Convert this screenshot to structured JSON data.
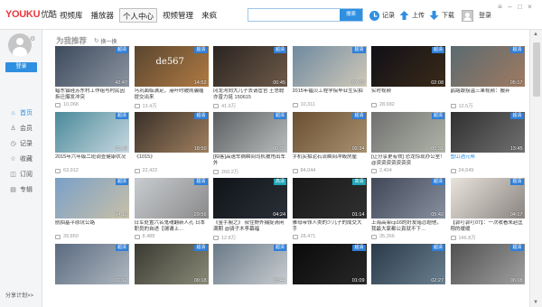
{
  "app": {
    "logo_you": "YOUKU",
    "logo_sub": "优酷",
    "nav": [
      "视频库",
      "播放器",
      "个人中心",
      "视频管理",
      "来疯"
    ],
    "search": {
      "placeholder": "",
      "button": "搜索"
    },
    "tools": {
      "record": "记录",
      "upload": "上传",
      "download": "下载",
      "login": "登录"
    },
    "window_controls": [
      "≡",
      "–",
      "□",
      "×"
    ]
  },
  "sidebar": {
    "login_button": "登录",
    "menu": [
      {
        "icon": "home-icon",
        "glyph": "⌂",
        "label": "首页"
      },
      {
        "icon": "member-icon",
        "glyph": "♙",
        "label": "会员"
      },
      {
        "icon": "history-icon",
        "glyph": "◷",
        "label": "记录"
      },
      {
        "icon": "favorite-icon",
        "glyph": "☆",
        "label": "收藏"
      },
      {
        "icon": "subscribe-icon",
        "glyph": "◫",
        "label": "订阅"
      },
      {
        "icon": "album-icon",
        "glyph": "▤",
        "label": "专辑"
      }
    ],
    "share_plan": "分享计划>>"
  },
  "main": {
    "section_title": "为我推荐",
    "refresh": "换一换",
    "videos": [
      {
        "title": "蜡东镇硅苏东村工作组与村民因拆迁爆发冲突",
        "views": "10,068",
        "duration": "42:47",
        "badge": "超清",
        "bg": [
          "#3c4a5c",
          "#8c94a0"
        ]
      },
      {
        "title": "冯巩面临满足，港叶时被闹骗缠提交出来",
        "views": "13.4万",
        "duration": "14:52",
        "badge": "超清",
        "bg": [
          "#5a4630",
          "#b07a42"
        ],
        "overlay": "de567"
      },
      {
        "title": "冈龙沟向大儿子去请宦官 王思聪亦曾力挺 150615",
        "views": "41.9万",
        "duration": "00:45",
        "badge": "超清",
        "bg": [
          "#2a2420",
          "#6e5a4a"
        ]
      },
      {
        "title": "2015年福贝工程学院毕业生实拍",
        "views": "10,311",
        "duration": "07:09",
        "badge": "超清",
        "bg": [
          "#6e8aa0",
          "#d0c8b8"
        ]
      },
      {
        "title": "实时视频",
        "views": "28,682",
        "duration": "02:08",
        "badge": "超清",
        "bg": [
          "#101018",
          "#3a2a18"
        ]
      },
      {
        "title": "鹊路跟拐温三果视频：搬弃",
        "views": "12.5万",
        "duration": "05:17",
        "badge": "超清",
        "bg": [
          "#5a6a70",
          "#a07a60"
        ]
      },
      {
        "title": "2015年六年级二班调查健康状况",
        "views": "63,912",
        "duration": "01:49",
        "badge": "超清",
        "bg": [
          "#4a8a9a",
          "#c8d8e0"
        ]
      },
      {
        "title": "《1015》",
        "views": "22,422",
        "duration": "18:50",
        "badge": "超清",
        "bg": [
          "#3a3028",
          "#a08060"
        ]
      },
      {
        "title": "[拍客]高速车祸瞬间司机被甩出车外",
        "views": "260.2万",
        "duration": "00:37",
        "badge": "超清",
        "bg": [
          "#5a5e60",
          "#b8bcbc"
        ]
      },
      {
        "title": "手机实拍泥石流瞬间冲毁房屋",
        "views": "84,044",
        "duration": "02:34",
        "badge": "超清",
        "bg": [
          "#6a5030",
          "#a89070"
        ]
      },
      {
        "title": "[让分享更有效] 恐龙惊现办公室！@资资资资资资资",
        "views": "2,404",
        "duration": "00:31",
        "badge": "超清",
        "bg": [
          "#707070",
          "#b0b4a8"
        ]
      },
      {
        "title": "塑山酒元帮",
        "views": "24,649",
        "duration": "13:45",
        "badge": "超清",
        "bg": [
          "#303030",
          "#707070"
        ],
        "link": true
      },
      {
        "title": "航拍基平原坑公路",
        "views": "39,850",
        "duration": "04:18",
        "badge": "超清",
        "bg": [
          "#7aa0c8",
          "#c8c0a8"
        ]
      },
      {
        "title": "日军处置六名鬼魂翻新人孔 日本职员的自述【谓谓上…",
        "views": "8,488",
        "duration": "29:56",
        "badge": "超清",
        "bg": [
          "#c8ccd0",
          "#8a8a8a"
        ]
      },
      {
        "title": "《金手腕之》 叔住野外捕捉清闲满期 @骑子木李幕福",
        "views": "12.8万",
        "duration": "04:24",
        "badge": "高清",
        "hd": true,
        "bg": [
          "#101418",
          "#2a3038"
        ]
      },
      {
        "title": "雅母带领人类的少儿子的成交大手",
        "views": "28,471",
        "duration": "01:14",
        "badge": "高清",
        "hd": true,
        "bg": [
          "#181818",
          "#303030"
        ]
      },
      {
        "title": "上海高架cp16的好友暗恋题他，我最大家都公真就不下…",
        "views": "35,366",
        "duration": "05:42",
        "badge": "超清",
        "bg": [
          "#404858",
          "#8890a0"
        ]
      },
      {
        "title": "【郭叮郭叮07】：一次收看未赵匡翔的缓缓",
        "views": "146.8万",
        "duration": "04:17",
        "badge": "超清",
        "bg": [
          "#e8e4dc",
          "#8a8480"
        ]
      },
      {
        "title": "",
        "views": "",
        "duration": "01:12",
        "badge": "超清",
        "bg": [
          "#5a6a80",
          "#b0b8c0"
        ]
      },
      {
        "title": "",
        "views": "",
        "duration": "09:18",
        "badge": "超清",
        "bg": [
          "#3a3a32",
          "#8a8a78"
        ]
      },
      {
        "title": "",
        "views": "",
        "duration": "05:44",
        "badge": "超清",
        "bg": [
          "#6a7a88",
          "#c8ccd0"
        ]
      },
      {
        "title": "",
        "views": "",
        "duration": "01:09",
        "badge": "超清",
        "bg": [
          "#0a0a0a",
          "#282828"
        ]
      },
      {
        "title": "",
        "views": "",
        "duration": "02:27",
        "badge": "超清",
        "bg": [
          "#2a3a48",
          "#6a8090"
        ]
      },
      {
        "title": "",
        "views": "",
        "duration": "06:08",
        "badge": "超清",
        "bg": [
          "#505050",
          "#a0a0a0"
        ]
      }
    ]
  }
}
